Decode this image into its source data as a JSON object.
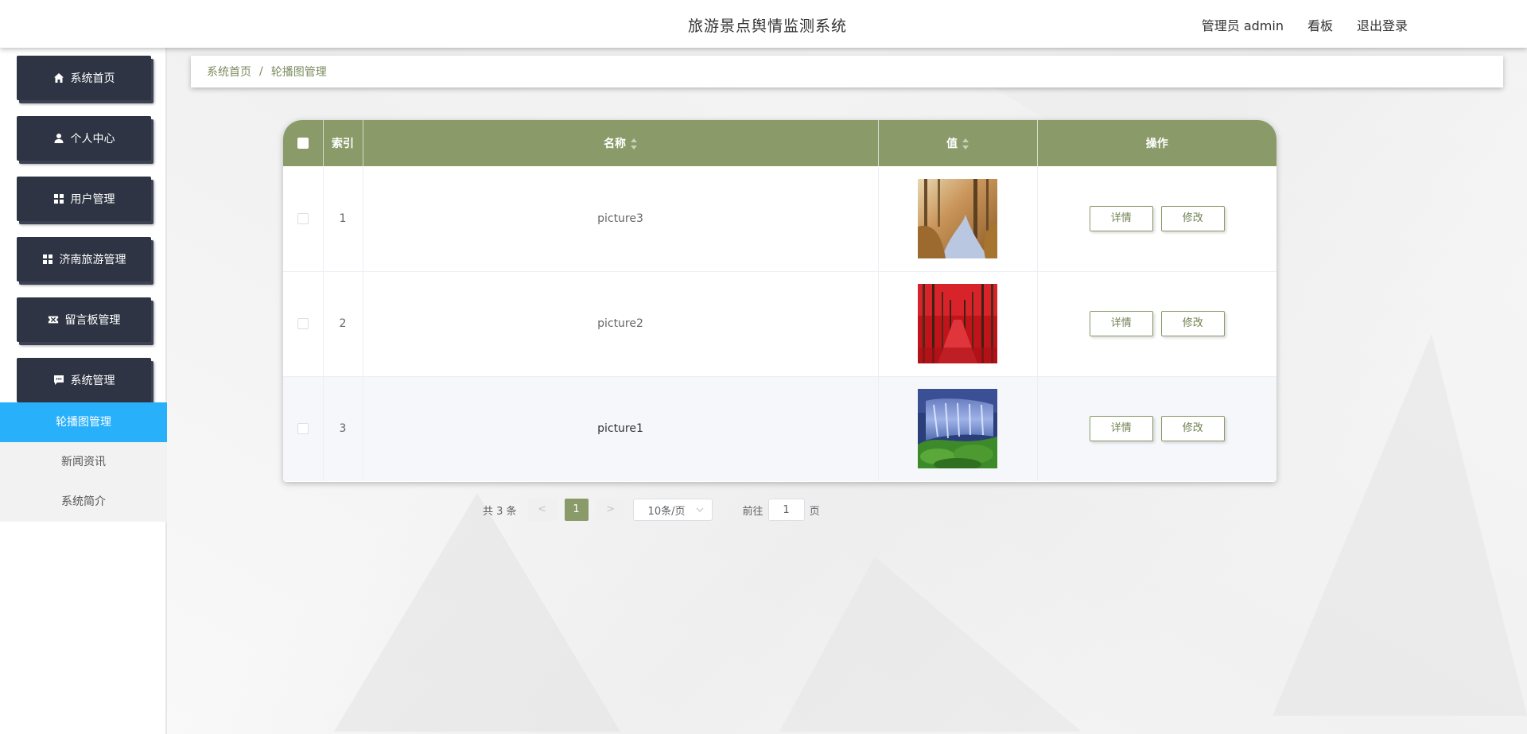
{
  "header": {
    "title": "旅游景点舆情监测系统",
    "user": "管理员 admin",
    "board": "看板",
    "logout": "退出登录"
  },
  "sidebar": {
    "items": [
      {
        "label": "系统首页",
        "icon": "home-icon"
      },
      {
        "label": "个人中心",
        "icon": "user-icon"
      },
      {
        "label": "用户管理",
        "icon": "grid-icon"
      },
      {
        "label": "济南旅游管理",
        "icon": "grid-icon"
      },
      {
        "label": "留言板管理",
        "icon": "ticket-icon"
      },
      {
        "label": "系统管理",
        "icon": "message-icon"
      }
    ],
    "submenu": [
      {
        "label": "轮播图管理",
        "active": true
      },
      {
        "label": "新闻资讯",
        "active": false
      },
      {
        "label": "系统简介",
        "active": false
      }
    ]
  },
  "breadcrumb": {
    "home": "系统首页",
    "separator": "/",
    "current": "轮播图管理"
  },
  "table": {
    "headers": {
      "index": "索引",
      "name": "名称",
      "value": "值",
      "actions": "操作"
    },
    "rows": [
      {
        "index": "1",
        "name": "picture3",
        "image": "autumn-forest-river"
      },
      {
        "index": "2",
        "name": "picture2",
        "image": "red-tree-avenue"
      },
      {
        "index": "3",
        "name": "picture1",
        "image": "waterfall-moss"
      }
    ],
    "detail_label": "详情",
    "edit_label": "修改"
  },
  "pagination": {
    "total": "共 3 条",
    "prev": "<",
    "current_page": "1",
    "next": ">",
    "page_size": "10条/页",
    "goto_label": "前往",
    "goto_value": "1",
    "page_suffix": "页"
  },
  "colors": {
    "accent": "#8a9a69",
    "sidebar_item": "#2e3443",
    "active_sub": "#29b0fb"
  }
}
